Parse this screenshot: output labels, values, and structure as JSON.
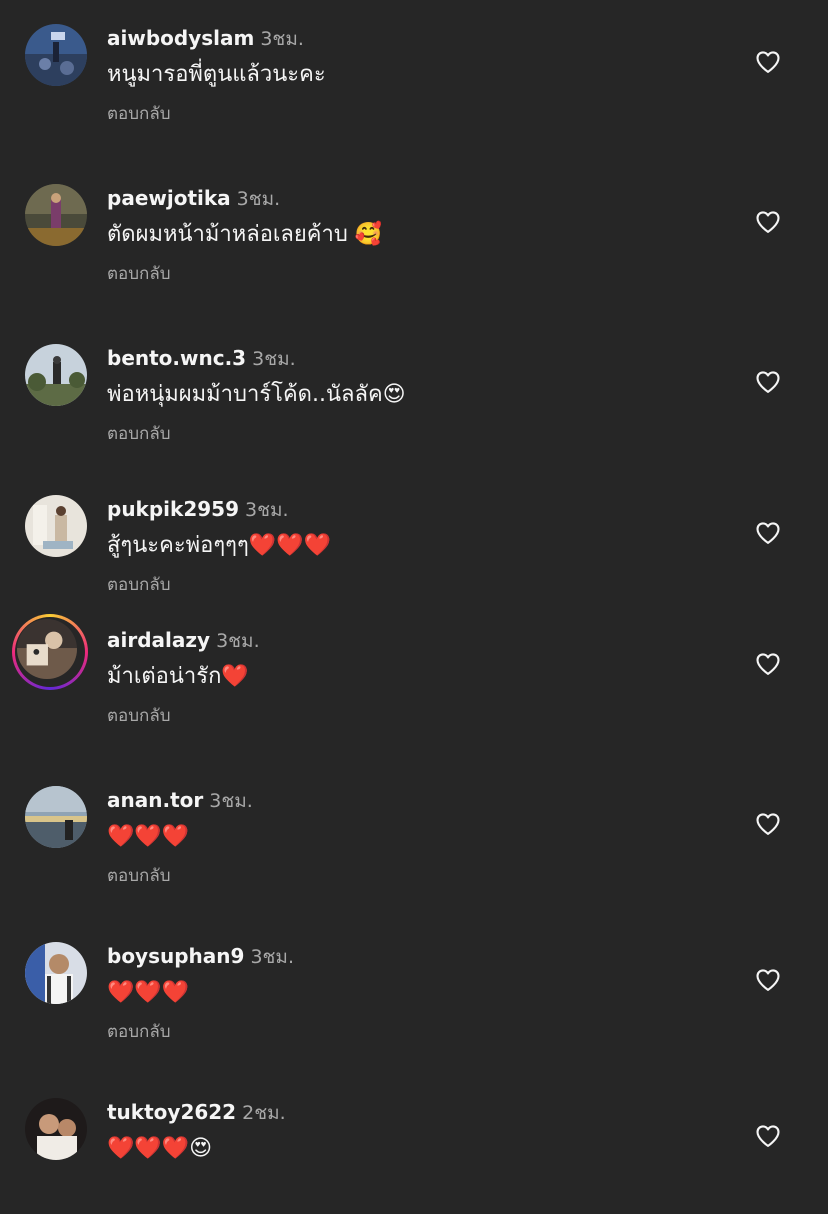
{
  "colors": {
    "background": "#262626",
    "primary_text": "#f5f5f5",
    "secondary_text": "#a8a8a8",
    "story_ring": "#ee2a7b"
  },
  "icons": {
    "like": "heart-outline-icon"
  },
  "comments": [
    {
      "username": "aiwbodyslam",
      "time": "3ชม.",
      "text": "หนูมารอพี่ตูนแล้วนะคะ",
      "reply": "ตอบกลับ"
    },
    {
      "username": "paewjotika",
      "time": "3ชม.",
      "text": "ตัดผมหน้าม้าหล่อเลยค้าบ 🥰",
      "reply": "ตอบกลับ"
    },
    {
      "username": "bento.wnc.3",
      "time": "3ชม.",
      "text": "พ่อหนุ่มผมม้าบาร์โค้ด..นัลลัค😍",
      "reply": "ตอบกลับ"
    },
    {
      "username": "pukpik2959",
      "time": "3ชม.",
      "text": "สู้ๆนะคะพ่อๆๆๆ❤️❤️❤️",
      "reply": "ตอบกลับ"
    },
    {
      "username": "airdalazy",
      "time": "3ชม.",
      "text": "ม้าเต่อน่ารัก❤️",
      "reply": "ตอบกลับ"
    },
    {
      "username": "anan.tor",
      "time": "3ชม.",
      "text": "❤️❤️❤️",
      "reply": "ตอบกลับ"
    },
    {
      "username": "boysuphan9",
      "time": "3ชม.",
      "text": "❤️❤️❤️",
      "reply": "ตอบกลับ"
    },
    {
      "username": "tuktoy2622",
      "time": "2ชม.",
      "text": "❤️❤️❤️😍",
      "reply": ""
    }
  ]
}
